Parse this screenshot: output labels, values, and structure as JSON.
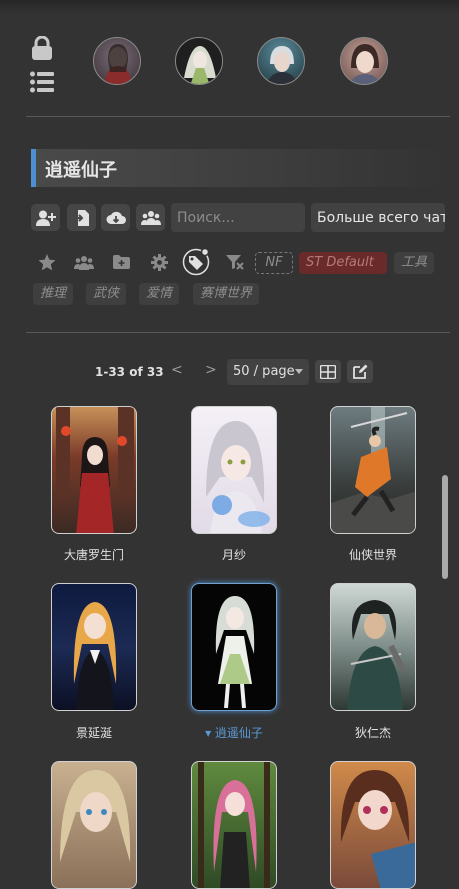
{
  "title": "逍遥仙子",
  "search": {
    "placeholder": "Поиск..."
  },
  "sort": {
    "selected": "Больше всего чатов"
  },
  "filter_tags": [
    "NF",
    "ST Default",
    "工具",
    "推理",
    "武侠",
    "爱情",
    "赛博世界"
  ],
  "pager": {
    "range": "1-33 of 33",
    "prev": "<",
    "next": ">",
    "per_page": "50 / page"
  },
  "characters": [
    {
      "name": "大唐罗生门"
    },
    {
      "name": "月纱"
    },
    {
      "name": "仙侠世界"
    },
    {
      "name": "景延涎"
    },
    {
      "name": "逍遥仙子",
      "selected_marker": "▾"
    },
    {
      "name": "狄仁杰"
    },
    {
      "name": ""
    },
    {
      "name": ""
    },
    {
      "name": ""
    }
  ],
  "colors": {
    "accent": "#4d8fd1",
    "tag_red": "#6b2a2a",
    "bg": "#333333"
  },
  "icons": [
    "lock-icon",
    "list-icon",
    "add-user-icon",
    "import-icon",
    "download-icon",
    "group-icon",
    "star-icon",
    "users-icon",
    "folder-icon",
    "gear-icon",
    "tags-icon",
    "filter-off-icon",
    "grid-icon",
    "edit-icon"
  ]
}
